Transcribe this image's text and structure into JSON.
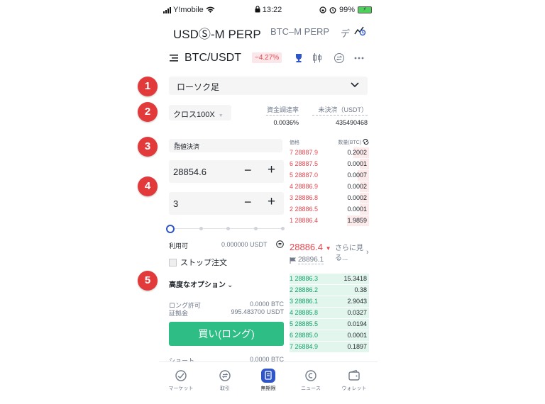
{
  "status_bar": {
    "carrier": "Y!mobile",
    "time": "13:22",
    "battery": "99%"
  },
  "contract_tabs": {
    "active": "USDⓈ-M PERP",
    "other": "BTC–M PERP",
    "demo": "デ"
  },
  "pair": {
    "symbol": "BTC/USDT",
    "change": "−4.27%"
  },
  "chart_type": {
    "label": "ローソク足"
  },
  "margin": {
    "label": "クロス100X"
  },
  "funding": {
    "label": "資金調達率",
    "value": "0.0036%"
  },
  "open_interest": {
    "label": "未決済（USDT）",
    "value": "435490468"
  },
  "order_type": {
    "label": "指値決済"
  },
  "price_input": {
    "value": "28854.6"
  },
  "qty_input": {
    "value": "3"
  },
  "slider": {
    "value_percent": 0
  },
  "available": {
    "label": "利用可",
    "value": "0.000000 USDT"
  },
  "stop_order": {
    "label": "ストップ注文"
  },
  "advanced": {
    "label": "高度なオプション"
  },
  "long_allow": {
    "label": "ロング許可",
    "value": "0.0000 BTC"
  },
  "margin_req": {
    "label": "証拠金",
    "value": "995.483700 USDT"
  },
  "buy_button": {
    "label": "買い(ロング)"
  },
  "short": {
    "label": "ショート",
    "value": "0.0000 BTC"
  },
  "orderbook": {
    "price_header": "価格",
    "qty_header": "数量(BTC)",
    "asks": [
      {
        "price": "7 28887.9",
        "qty": "0.2002",
        "depth": 0.2
      },
      {
        "price": "6 28887.5",
        "qty": "0.0001",
        "depth": 0.12
      },
      {
        "price": "5 28887.0",
        "qty": "0.0007",
        "depth": 0.14
      },
      {
        "price": "4 28886.9",
        "qty": "0.0002",
        "depth": 0.12
      },
      {
        "price": "3 28886.8",
        "qty": "0.0002",
        "depth": 0.12
      },
      {
        "price": "2 28886.5",
        "qty": "0.0001",
        "depth": 0.12
      },
      {
        "price": "1 28886.4",
        "qty": "1.9859",
        "depth": 0.28
      }
    ],
    "last_price": "28886.4",
    "more_label": "さらに見る...",
    "mark_price": "28896.1",
    "bids": [
      {
        "price": "1 28886.3",
        "qty": "15.3418",
        "depth": 1.0
      },
      {
        "price": "2 28886.2",
        "qty": "0.38",
        "depth": 1.0
      },
      {
        "price": "3 28886.1",
        "qty": "2.9043",
        "depth": 1.0
      },
      {
        "price": "4 28885.8",
        "qty": "0.0327",
        "depth": 1.0
      },
      {
        "price": "5 28885.5",
        "qty": "0.0194",
        "depth": 1.0
      },
      {
        "price": "6 28885.0",
        "qty": "0.0001",
        "depth": 1.0
      },
      {
        "price": "7 26884.9",
        "qty": "0.1897",
        "depth": 1.0
      }
    ]
  },
  "nav": {
    "items": [
      {
        "label": "マーケット",
        "icon": "market-icon"
      },
      {
        "label": "取引",
        "icon": "trade-icon"
      },
      {
        "label": "無期限",
        "icon": "futures-icon",
        "active": true
      },
      {
        "label": "ニュース",
        "icon": "news-icon"
      },
      {
        "label": "ウォレット",
        "icon": "wallet-icon"
      }
    ]
  },
  "markers": [
    "1",
    "2",
    "3",
    "4",
    "5"
  ],
  "colors": {
    "accent_blue": "#2f56c9",
    "buy_green": "#2ebd85",
    "sell_red": "#e8474f",
    "marker_red": "#e23a3a"
  }
}
